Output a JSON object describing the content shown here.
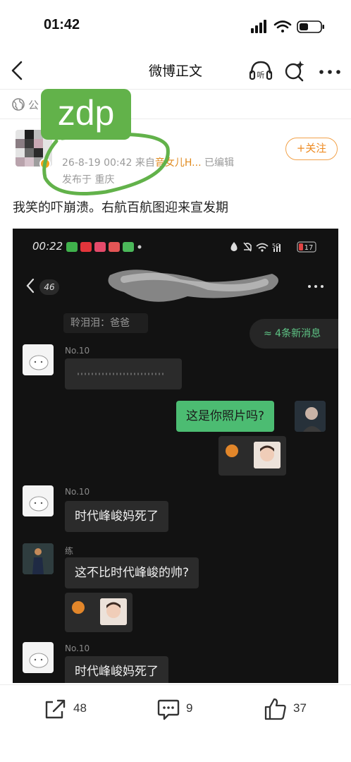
{
  "status_bar": {
    "time": "01:42"
  },
  "nav": {
    "title": "微博正文",
    "listen_label": "听"
  },
  "visibility": {
    "label": "公"
  },
  "post": {
    "meta_prefix": "26-8-19 00:42  来自",
    "meta_source": "音女儿H...",
    "meta_edited": "已编辑",
    "location": "发布于 重庆",
    "follow_label": "+关注",
    "text": "我笑的",
    "text_rest": "崩溃。右航百航图迎来宣发期",
    "watermark": "zdp"
  },
  "embedded": {
    "time": "00:22",
    "network": "5G",
    "battery": "17",
    "unread_count": "46",
    "prev_message": "聆泪泪：爸爸",
    "new_messages": "≈ 4条新消息",
    "messages": [
      {
        "sender": "No.10",
        "text": ""
      },
      {
        "sender": "",
        "text": "这是你照片吗?"
      },
      {
        "sender": "No.10",
        "text": "时代峰峻妈死了"
      },
      {
        "sender": "练",
        "text": "这不比时代峰峻的帅?"
      },
      {
        "sender": "No.10",
        "text": "时代峰峻妈死了"
      }
    ]
  },
  "actions": {
    "share_count": "48",
    "comment_count": "9",
    "like_count": "37"
  },
  "colors": {
    "accent_orange": "#ee8a20",
    "watermark_green": "#62b24a",
    "chat_green": "#4cbc72"
  }
}
